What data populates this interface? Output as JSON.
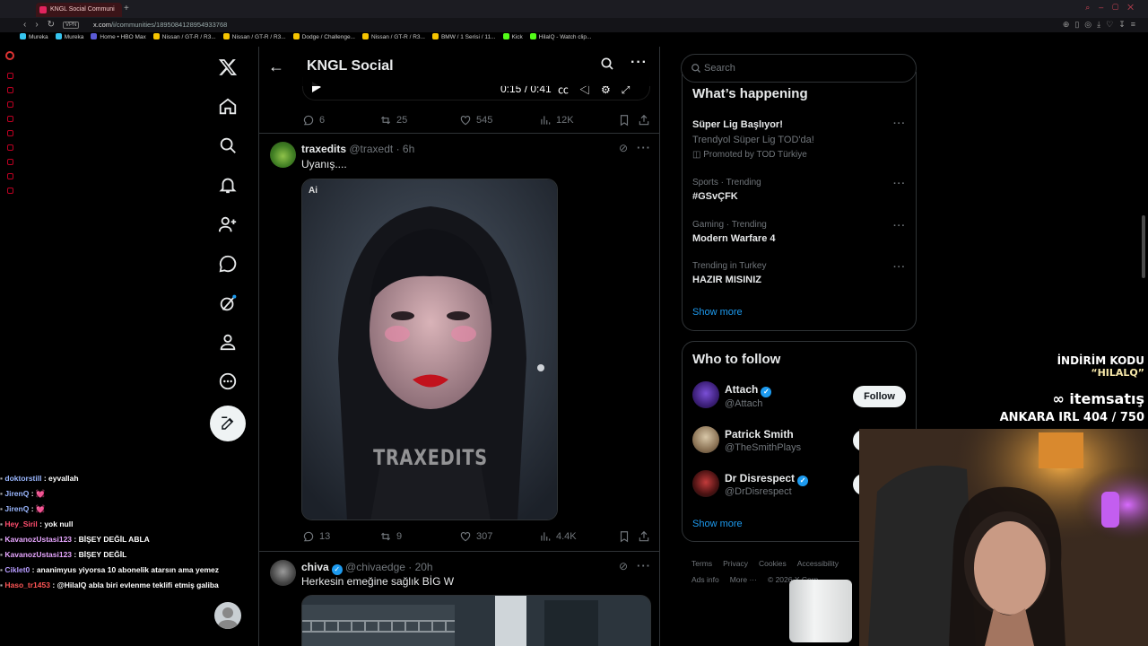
{
  "browser": {
    "tab_title": "KNGL Social Communi",
    "vpn_label": "VPN",
    "url_host": "x.com",
    "url_path": "/i/communities/1895084128954933768",
    "bookmarks": [
      "Mureka",
      "Mureka",
      "Home • HBO Max",
      "Nissan / GT-R / R3...",
      "Nissan / GT-R / R3...",
      "Dodge / Challenge...",
      "Nissan / GT-R / R3...",
      "BMW / 1 Serisi / 11...",
      "Kick",
      "HilalQ - Watch clip..."
    ]
  },
  "header": {
    "title": "KNGL Social"
  },
  "video": {
    "time": "0:15 / 0:41"
  },
  "post0_stats": {
    "replies": "6",
    "reposts": "25",
    "likes": "545",
    "views": "12K"
  },
  "post1": {
    "name": "traxedits",
    "handle": "@traxedt · 6h",
    "text": "Uyanış....",
    "badge": "Ai",
    "watermark": "TRAXEDITS",
    "replies": "13",
    "reposts": "9",
    "likes": "307",
    "views": "4.4K"
  },
  "post2": {
    "name": "chiva",
    "handle": "@chivaedge · 20h",
    "text": "Herkesin emeğine sağlık BİG W"
  },
  "search": {
    "placeholder": "Search"
  },
  "trends": {
    "title": "What’s happening",
    "items": [
      {
        "meta": "",
        "name": "Süper Lig Başlıyor!",
        "sub": "Trendyol Süper Lig TOD'da!",
        "promo": "Promoted by TOD Türkiye"
      },
      {
        "meta": "Sports · Trending",
        "name": "#GSvÇFK"
      },
      {
        "meta": "Gaming · Trending",
        "name": "Modern Warfare 4"
      },
      {
        "meta": "Trending in Turkey",
        "name": "HAZIR MISINIZ"
      }
    ],
    "show_more": "Show more"
  },
  "who_to_follow": {
    "title": "Who to follow",
    "users": [
      {
        "name": "Attach",
        "handle": "@Attach",
        "verified": true
      },
      {
        "name": "Patrick Smith",
        "handle": "@TheSmithPlays",
        "verified": false
      },
      {
        "name": "Dr Disrespect",
        "handle": "@DrDisrespect",
        "verified": true
      }
    ],
    "follow_label": "Follow",
    "show_more": "Show more"
  },
  "footer": {
    "links": [
      "Terms",
      "Privacy",
      "Cookies",
      "Accessibility",
      "Ads info",
      "More ···",
      "© 2026 X Corp."
    ]
  },
  "chat": [
    {
      "user": "doktorstill",
      "msg": ": eyvallah",
      "color": "#9ab7ff"
    },
    {
      "user": "JirenQ",
      "msg": ": 💓",
      "color": "#9ab7ff"
    },
    {
      "user": "JirenQ",
      "msg": ": 💓",
      "color": "#9ab7ff"
    },
    {
      "user": "Hey_Siril",
      "msg": ": yok null",
      "color": "#ff4d6d"
    },
    {
      "user": "KavanozUstasi123",
      "msg": ": BİŞEY DEĞİL ABLA",
      "color": "#e7a6ff"
    },
    {
      "user": "KavanozUstasi123",
      "msg": ": BİŞEY DEĞİL",
      "color": "#e7a6ff"
    },
    {
      "user": "Ciklet0",
      "msg": ": ananimyus yiyorsa 10 abonelik atarsın ama yemez",
      "color": "#b79cff"
    },
    {
      "user": "Haso_tr1453",
      "msg": ": @HilalQ abla biri evlenme teklifi etmiş galiba",
      "color": "#ff5555"
    }
  ],
  "overlay": {
    "promo_label": "İNDİRİM KODU",
    "promo_code": "“HILALQ”",
    "sponsor": "itemsatış",
    "counter": "ANKARA IRL 404 / 750"
  }
}
